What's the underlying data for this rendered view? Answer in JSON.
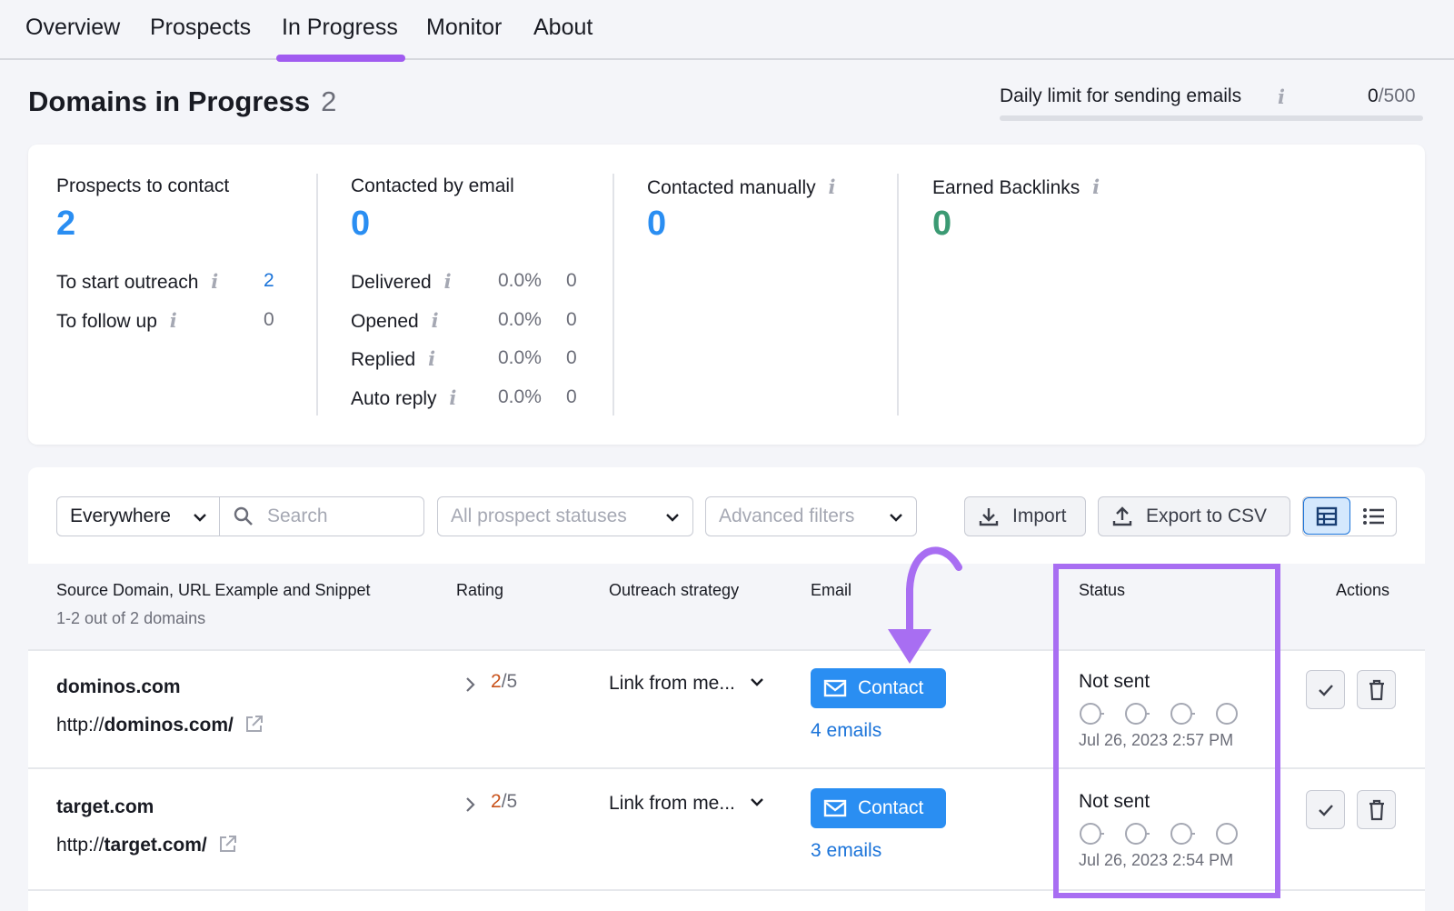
{
  "nav": {
    "tabs": [
      {
        "label": "Overview"
      },
      {
        "label": "Prospects"
      },
      {
        "label": "In Progress"
      },
      {
        "label": "Monitor"
      },
      {
        "label": "About"
      }
    ],
    "active": "In Progress"
  },
  "header": {
    "title": "Domains in Progress",
    "count": "2",
    "daily_limit_label": "Daily limit for sending emails",
    "daily_used": "0",
    "daily_total": "/500",
    "daily_fraction": 0
  },
  "stats": {
    "prospects": {
      "label": "Prospects to contact",
      "value": "2",
      "rows": [
        {
          "label": "To start outreach",
          "value": "2"
        },
        {
          "label": "To follow up",
          "value": "0"
        }
      ]
    },
    "email": {
      "label": "Contacted by email",
      "value": "0",
      "rows": [
        {
          "label": "Delivered",
          "pct": "0.0%",
          "value": "0"
        },
        {
          "label": "Opened",
          "pct": "0.0%",
          "value": "0"
        },
        {
          "label": "Replied",
          "pct": "0.0%",
          "value": "0"
        },
        {
          "label": "Auto reply",
          "pct": "0.0%",
          "value": "0"
        }
      ]
    },
    "manual": {
      "label": "Contacted manually",
      "value": "0"
    },
    "backlinks": {
      "label": "Earned Backlinks",
      "value": "0"
    }
  },
  "filters": {
    "scope": "Everywhere",
    "search_placeholder": "Search",
    "statuses": "All prospect statuses",
    "advanced": "Advanced filters",
    "import": "Import",
    "export": "Export to CSV"
  },
  "table": {
    "headers": {
      "source": "Source Domain, URL Example and Snippet",
      "source_sub": "1-2 out of 2 domains",
      "rating": "Rating",
      "strategy": "Outreach strategy",
      "email": "Email",
      "status": "Status",
      "actions": "Actions"
    },
    "rows": [
      {
        "domain": "dominos.com",
        "url_prefix": "http://",
        "url_host": "dominos.com/",
        "rating": "2",
        "rating_max": "/5",
        "strategy": "Link from me...",
        "contact": "Contact",
        "emails": "4 emails",
        "status": "Not sent",
        "date": "Jul 26, 2023 2:57 PM"
      },
      {
        "domain": "target.com",
        "url_prefix": "http://",
        "url_host": "target.com/",
        "rating": "2",
        "rating_max": "/5",
        "strategy": "Link from me...",
        "contact": "Contact",
        "emails": "3 emails",
        "status": "Not sent",
        "date": "Jul 26, 2023 2:54 PM"
      }
    ]
  },
  "colors": {
    "accent_purple": "#a86ef2",
    "primary_blue": "#2a8ef2",
    "backlinks_green": "#3b9a73",
    "rating_orange": "#c9531c"
  }
}
